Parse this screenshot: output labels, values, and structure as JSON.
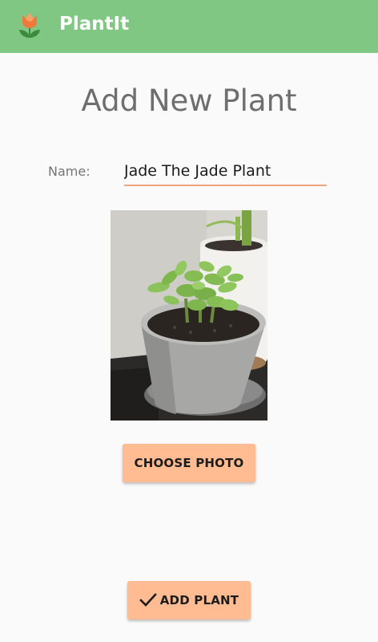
{
  "app_bar": {
    "title": "PlantIt",
    "logo_icon": "tulip-icon",
    "background_color": "#7fc782"
  },
  "form": {
    "page_title": "Add New Plant",
    "name_label": "Name:",
    "name_value": "Jade The Jade Plant",
    "photo_icon": "plant-photo"
  },
  "buttons": {
    "choose_photo_label": "CHOOSE PHOTO",
    "add_plant_label": "ADD PLANT",
    "add_plant_icon": "check-icon",
    "button_color": "#ffbc93"
  },
  "accent_color": "#f0a37f"
}
